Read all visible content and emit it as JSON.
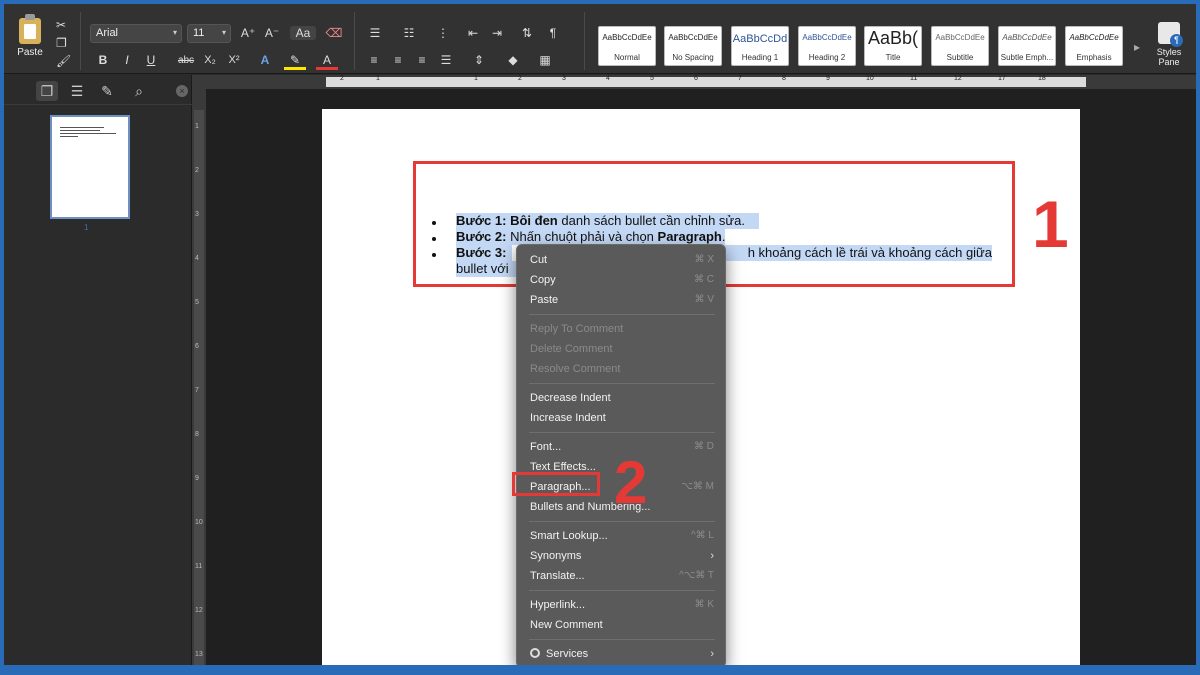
{
  "ribbon": {
    "paste_label": "Paste",
    "font_name": "Arial",
    "font_size": "11",
    "grow_font": "A⁺",
    "shrink_font": "A⁻",
    "bold": "B",
    "italic": "I",
    "underline": "U",
    "strike": "abc",
    "subscript": "X₂",
    "superscript": "X²",
    "pilcrow": "¶",
    "styles": [
      {
        "sample": "AaBbCcDdEe",
        "name": "Normal"
      },
      {
        "sample": "AaBbCcDdEe",
        "name": "No Spacing"
      },
      {
        "sample": "AaBbCcDd",
        "name": "Heading 1"
      },
      {
        "sample": "AaBbCcDdEe",
        "name": "Heading 2"
      },
      {
        "sample": "AaBb(",
        "name": "Title"
      },
      {
        "sample": "AaBbCcDdEe",
        "name": "Subtitle"
      },
      {
        "sample": "AaBbCcDdEe",
        "name": "Subtle Emph..."
      },
      {
        "sample": "AaBbCcDdEe",
        "name": "Emphasis"
      }
    ],
    "styles_pane_line1": "Styles",
    "styles_pane_line2": "Pane"
  },
  "sidebar": {
    "page_number": "1"
  },
  "document": {
    "line1_bold": "Bước 1:",
    "line1_bold2": "Bôi đen",
    "line1_rest": "danh sách bullet cần chỉnh sửa.",
    "line2_bold": "Bước 2:",
    "line2_rest": "Nhấn chuột phải và chọn",
    "line2_bold2": "Paragraph",
    "line2_end": ".",
    "line3_bold": "Bước 3:",
    "line3_rest": "h khoảng cách lề trái và khoảng cách giữa",
    "line4": "bullet với"
  },
  "annotations": {
    "label1": "1",
    "label2": "2"
  },
  "context_menu": {
    "items": [
      {
        "label": "Cut",
        "shortcut": "⌘ X"
      },
      {
        "label": "Copy",
        "shortcut": "⌘ C"
      },
      {
        "label": "Paste",
        "shortcut": "⌘ V"
      },
      {
        "label": "Reply To Comment",
        "shortcut": ""
      },
      {
        "label": "Delete Comment",
        "shortcut": ""
      },
      {
        "label": "Resolve Comment",
        "shortcut": ""
      },
      {
        "label": "Decrease Indent",
        "shortcut": ""
      },
      {
        "label": "Increase Indent",
        "shortcut": ""
      },
      {
        "label": "Font...",
        "shortcut": "⌘ D"
      },
      {
        "label": "Text Effects...",
        "shortcut": ""
      },
      {
        "label": "Paragraph...",
        "shortcut": "⌥⌘ M"
      },
      {
        "label": "Bullets and Numbering...",
        "shortcut": ""
      },
      {
        "label": "Smart Lookup...",
        "shortcut": "^⌘ L"
      },
      {
        "label": "Synonyms",
        "shortcut": ""
      },
      {
        "label": "Translate...",
        "shortcut": "^⌥⌘ T"
      },
      {
        "label": "Hyperlink...",
        "shortcut": "⌘ K"
      },
      {
        "label": "New Comment",
        "shortcut": ""
      },
      {
        "label": "Services",
        "shortcut": ""
      }
    ]
  },
  "colors": {
    "accent": "#e53935",
    "selection": "#c3d8f5",
    "frame": "#2a6bb8"
  }
}
